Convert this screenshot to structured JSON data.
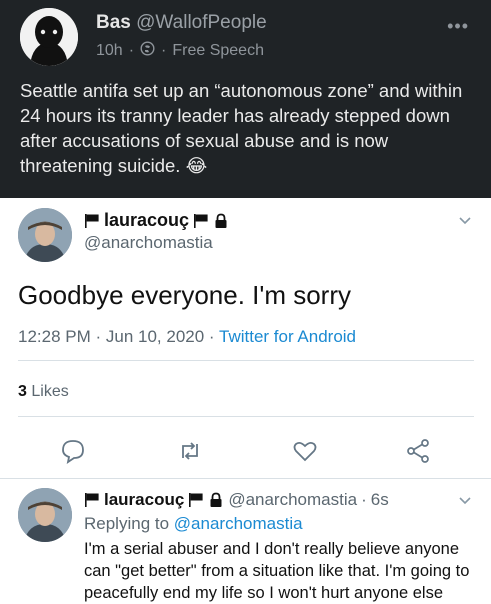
{
  "original_post": {
    "display_name": "Bas",
    "handle": "@WallofPeople",
    "time": "10h",
    "separator": "·",
    "circle": "Free Speech",
    "text": "Seattle antifa set up an “autonomous zone” and within 24 hours its tranny leader has already stepped down after accusations of sexual abuse and is now threatening suicide. 😂",
    "more_icon": "more-dots-icon"
  },
  "tweet": {
    "display_name": "lauracouç",
    "handle": "@anarchomastia",
    "text": "Goodbye everyone. I'm sorry",
    "time": "12:28 PM",
    "date": "Jun 10, 2020",
    "source": "Twitter for Android",
    "likes_count": "3",
    "likes_label": "Likes",
    "actions": [
      "reply-icon",
      "retweet-icon",
      "like-icon",
      "share-icon"
    ]
  },
  "reply": {
    "display_name": "lauracouç",
    "handle": "@anarchomastia",
    "age": "6s",
    "replying_prefix": "Replying to",
    "replying_to": "@anarchomastia",
    "text": "I'm a serial abuser and I don't really believe anyone can \"get better\" from a situation like that. I'm going to peacefully end my life so I won't hurt anyone else"
  },
  "colors": {
    "dark_bg": "#1f2326",
    "link_blue": "#1b8ad2",
    "muted_gray": "#5b6770"
  }
}
